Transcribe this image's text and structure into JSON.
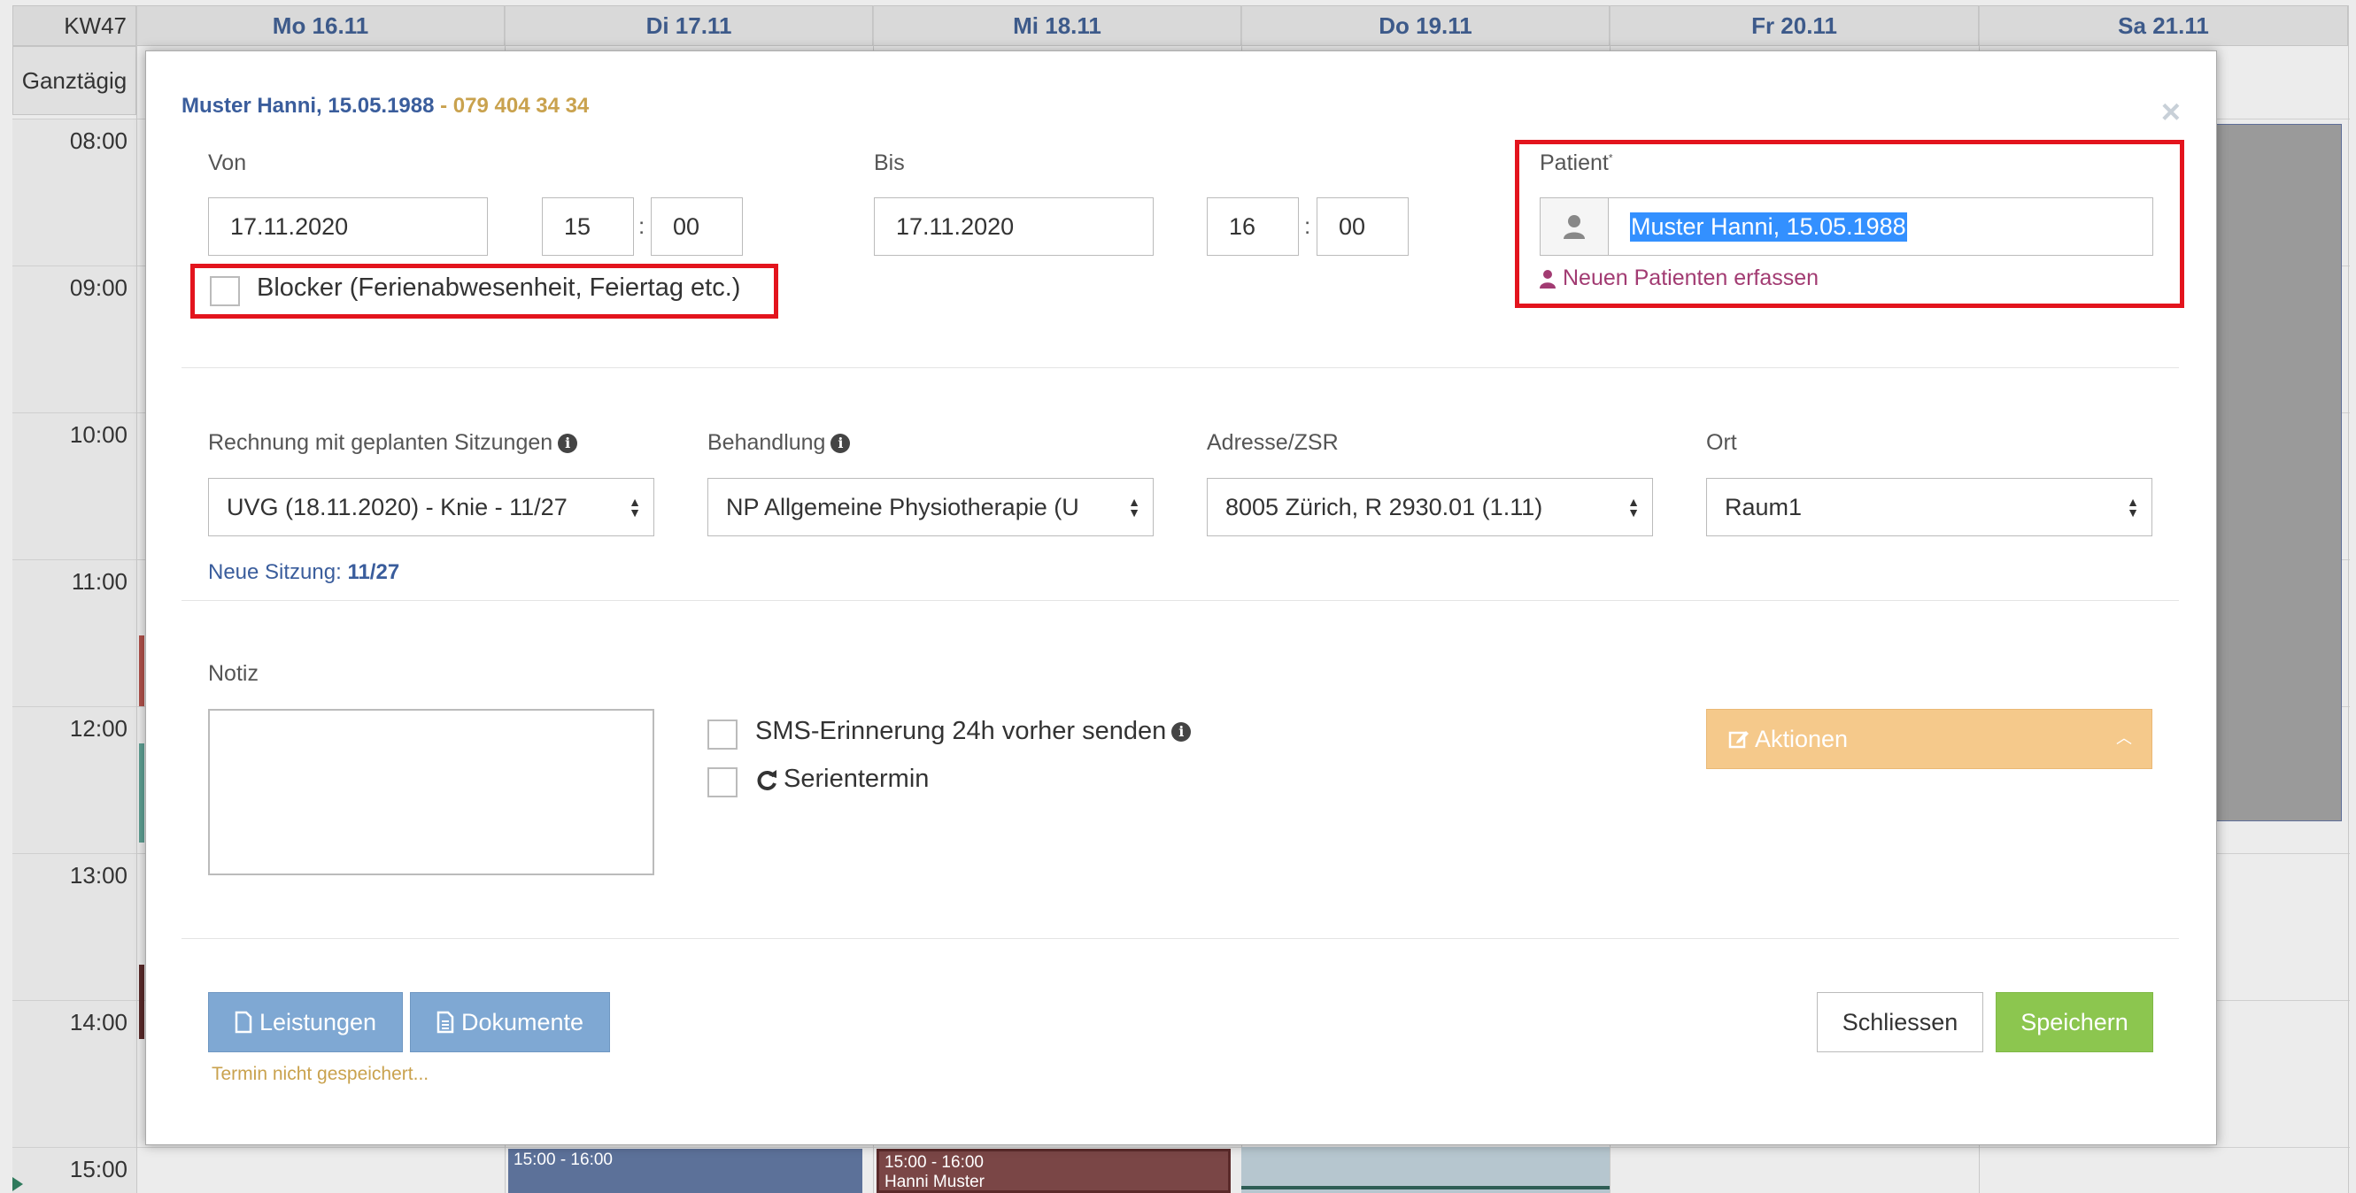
{
  "calendar": {
    "week": "KW47",
    "days": [
      "Mo 16.11",
      "Di 17.11",
      "Mi 18.11",
      "Do 19.11",
      "Fr 20.11",
      "Sa 21.11"
    ],
    "allday_label": "Ganztägig",
    "hours": [
      "08:00",
      "09:00",
      "10:00",
      "11:00",
      "12:00",
      "13:00",
      "14:00",
      "15:00"
    ],
    "events": [
      {
        "time": "15:00 - 16:00",
        "title": "",
        "color": "#5c7199"
      },
      {
        "time": "15:00 - 16:00",
        "title": "Hanni Muster",
        "color": "#7a4646"
      }
    ]
  },
  "modal": {
    "title_patient": "Muster Hanni, 15.05.1988",
    "title_sep": " - ",
    "title_phone": "079 404 34 34",
    "close_icon": "×",
    "von_label": "Von",
    "von_date": "17.11.2020",
    "von_hour": "15",
    "von_min": "00",
    "bis_label": "Bis",
    "bis_date": "17.11.2020",
    "bis_hour": "16",
    "bis_min": "00",
    "time_sep": ":",
    "blocker_label": "Blocker (Ferienabwesenheit, Feiertag etc.)",
    "patient_label": "Patient",
    "patient_required": "*",
    "patient_value": "Muster Hanni, 15.05.1988",
    "new_patient_link": "Neuen Patienten erfassen",
    "rechnung_label": "Rechnung mit geplanten Sitzungen",
    "rechnung_value": "UVG (18.11.2020) - Knie - 11/27",
    "behandlung_label": "Behandlung",
    "behandlung_value": "NP Allgemeine Physiotherapie (U",
    "adresse_label": "Adresse/ZSR",
    "adresse_value": "8005 Zürich, R 2930.01 (1.11)",
    "ort_label": "Ort",
    "ort_value": "Raum1",
    "neue_sitzung_label": "Neue Sitzung:",
    "neue_sitzung_value": "11/27",
    "notiz_label": "Notiz",
    "notiz_value": "",
    "sms_label": "SMS-Erinnerung 24h vorher senden",
    "serie_label": "Serientermin",
    "aktionen_label": "Aktionen",
    "leistungen_label": "Leistungen",
    "dokumente_label": "Dokumente",
    "schliessen_label": "Schliessen",
    "speichern_label": "Speichern",
    "status_text": "Termin nicht gespeichert..."
  },
  "colors": {
    "highlight": "#e3141d",
    "title_blue": "#3a5d9c",
    "phone_gold": "#c9a24e",
    "link_purple": "#a23b72",
    "save_green": "#8cc64f",
    "doc_blue": "#7fa8d3",
    "aktionen_orange": "#f5c98b"
  }
}
